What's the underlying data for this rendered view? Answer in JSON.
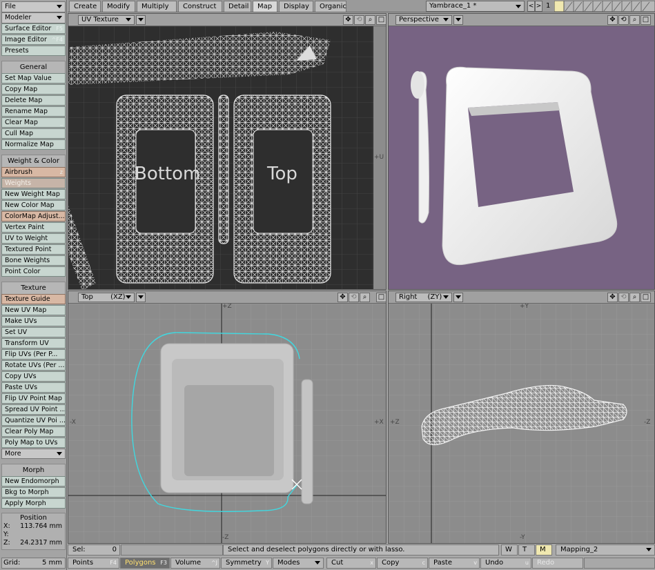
{
  "sidebar": {
    "file": "File",
    "modeler": "Modeler",
    "top_items": [
      {
        "label": "Surface Editor",
        "shortcut": "F5"
      },
      {
        "label": "Image Editor",
        "shortcut": "^F4"
      },
      {
        "label": "Presets",
        "shortcut": ""
      }
    ],
    "general_header": "General",
    "general_items": [
      {
        "label": "Set Map Value",
        "shortcut": ""
      },
      {
        "label": "Copy Map",
        "shortcut": ""
      },
      {
        "label": "Delete Map",
        "shortcut": ""
      },
      {
        "label": "Rename Map",
        "shortcut": ""
      },
      {
        "label": "Clear Map",
        "shortcut": "_"
      },
      {
        "label": "Cull Map",
        "shortcut": ""
      },
      {
        "label": "Normalize Map",
        "shortcut": ""
      }
    ],
    "weight_header": "Weight & Color",
    "weight_items": [
      {
        "label": "Airbrush",
        "shortcut": "z",
        "style": "orange"
      },
      {
        "label": "Weights",
        "shortcut": "",
        "style": "dis"
      },
      {
        "label": "New Weight Map",
        "shortcut": ""
      },
      {
        "label": "New Color Map",
        "shortcut": ""
      },
      {
        "label": "ColorMap Adjust...",
        "shortcut": "",
        "style": "orange"
      },
      {
        "label": "Vertex Paint",
        "shortcut": ""
      },
      {
        "label": "UV to Weight",
        "shortcut": ""
      },
      {
        "label": "Textured Point",
        "shortcut": ""
      },
      {
        "label": "Bone Weights",
        "shortcut": ""
      },
      {
        "label": "Point Color",
        "shortcut": ""
      }
    ],
    "texture_header": "Texture",
    "texture_items": [
      {
        "label": "Texture Guide",
        "shortcut": "",
        "style": "orange"
      },
      {
        "label": "New UV Map",
        "shortcut": ""
      },
      {
        "label": "Make UVs",
        "shortcut": ""
      },
      {
        "label": "Set UV",
        "shortcut": ""
      },
      {
        "label": "Transform UV",
        "shortcut": ""
      },
      {
        "label": "Flip UVs (Per P...",
        "shortcut": ""
      },
      {
        "label": "Rotate UVs (Per ...",
        "shortcut": ""
      },
      {
        "label": "Copy UVs",
        "shortcut": ""
      },
      {
        "label": "Paste UVs",
        "shortcut": ""
      },
      {
        "label": "Flip UV Point Map",
        "shortcut": ""
      },
      {
        "label": "Spread UV Point ...",
        "shortcut": ""
      },
      {
        "label": "Quantize UV Poi ...",
        "shortcut": ""
      },
      {
        "label": "Clear Poly Map",
        "shortcut": ""
      },
      {
        "label": "Poly Map to UVs",
        "shortcut": ""
      }
    ],
    "more": "More",
    "morph_header": "Morph",
    "morph_items": [
      {
        "label": "New Endomorph",
        "shortcut": ""
      },
      {
        "label": "Bkg to Morph",
        "shortcut": ""
      },
      {
        "label": "Apply Morph",
        "shortcut": ""
      }
    ],
    "position": {
      "title": "Position",
      "x_label": "X:",
      "x": "113.764 mm",
      "y_label": "Y:",
      "y": "",
      "z_label": "Z:",
      "z": "24.2317 mm"
    },
    "grid_label": "Grid:",
    "grid_value": "5 mm"
  },
  "tabs": [
    "Create",
    "Modify",
    "Multiply",
    "Construct",
    "Detail",
    "Map",
    "Display",
    "Organic"
  ],
  "active_tab": "Map",
  "object_name": "Yambrace_1 *",
  "layer_number": "1",
  "viewports": {
    "tl": {
      "view": "UV Texture",
      "axis_u": "+U",
      "labels": [
        "Bottom",
        "Top"
      ]
    },
    "tr": {
      "view": "Perspective"
    },
    "bl": {
      "view": "Top",
      "plane": "(XZ)",
      "pz": "+Z",
      "nz": "-Z",
      "px": "+X",
      "nx": "-X"
    },
    "br": {
      "view": "Right",
      "plane": "(ZY)",
      "py": "+Y",
      "ny": "-Y",
      "pz": "+Z",
      "nz": "-Z"
    }
  },
  "status": {
    "sel_label": "Sel:",
    "sel_value": "0",
    "message": "Select and deselect polygons directly or with lasso.",
    "w": "W",
    "t": "T",
    "m": "M",
    "vmap": "Mapping_2"
  },
  "bottom": {
    "points": "Points",
    "points_sc": "F4",
    "polygons": "Polygons",
    "polygons_sc": "F3",
    "volume": "Volume",
    "volume_sc": "^J",
    "symmetry": "Symmetry",
    "symmetry_sc": "Y",
    "modes": "Modes",
    "cut": "Cut",
    "cut_sc": "x",
    "copy": "Copy",
    "copy_sc": "c",
    "paste": "Paste",
    "paste_sc": "v",
    "undo": "Undo",
    "undo_sc": "u",
    "redo": "Redo"
  },
  "colors": {
    "perspective_bg": "#776383",
    "uv_bg": "#2e2e2e",
    "ortho_bg": "#8c8c8c",
    "lasso": "#40d8e0"
  }
}
